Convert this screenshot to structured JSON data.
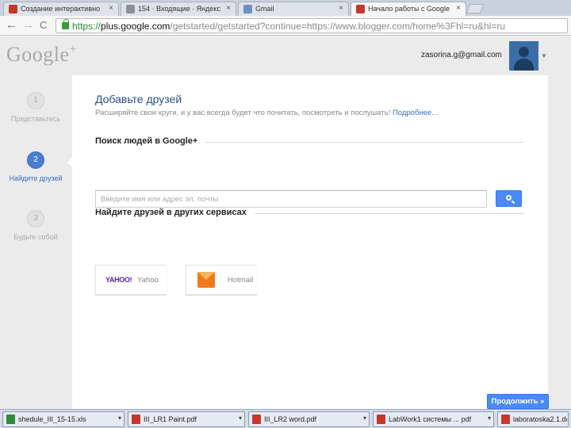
{
  "browser": {
    "tabs": [
      {
        "title": "Создание интерактивно",
        "close": "×",
        "favicon_color": "#c8362c",
        "active": false
      },
      {
        "title": "154 · Входящие · Яндекс",
        "close": "×",
        "favicon_color": "#8a8f99",
        "active": false
      },
      {
        "title": "Gmail",
        "close": "×",
        "favicon_color": "#6d8fc4",
        "active": false
      },
      {
        "title": "Начало работы с Google",
        "close": "×",
        "favicon_color": "#c8362c",
        "active": true
      }
    ],
    "back_icon": "←",
    "forward_icon": "→",
    "reload_icon": "C",
    "url": {
      "scheme": "https://",
      "host": "plus.google.com",
      "path": "/getstarted/getstarted?continue=https://www.blogger.com/home%3Fhl=ru&hl=ru"
    }
  },
  "header": {
    "logo": "Google",
    "logo_plus": "+",
    "email": "zasorina.g@gmail.com",
    "account_caret": "▼"
  },
  "steps": [
    {
      "number": "1",
      "label": "Представьтесь",
      "active": false
    },
    {
      "number": "2",
      "label": "Найдите друзей",
      "active": true
    },
    {
      "number": "3",
      "label": "Будьте собой",
      "active": false
    }
  ],
  "main": {
    "title": "Добавьте друзей",
    "subtitle": "Расширяйте свои круги, и у вас всегда будет что почитать, посмотреть и послушать!",
    "learn_more": "Подробнее...",
    "search_heading": "Поиск людей в Google+",
    "search_placeholder": "Введите имя или адрес эл. почты",
    "other_heading": "Найдите друзей в других сервисах",
    "services": [
      {
        "logo_text": "YAHOO!",
        "label": "Yahoo"
      },
      {
        "label": "Hotmail"
      }
    ],
    "continue_label": "Продолжить »"
  },
  "taskbar": {
    "items": [
      {
        "label": "shedule_III_15-15.xls",
        "icon_color": "#2f8a3a"
      },
      {
        "label": "III_LR1 Paint.pdf",
        "icon_color": "#c8362c"
      },
      {
        "label": "III_LR2 word.pdf",
        "icon_color": "#c8362c"
      },
      {
        "label": "LabWork1 системы ... pdf",
        "icon_color": "#c8362c"
      },
      {
        "label": "laboratoska2.1.do",
        "icon_color": "#c8362c"
      }
    ],
    "menu_arrow": "▾"
  }
}
